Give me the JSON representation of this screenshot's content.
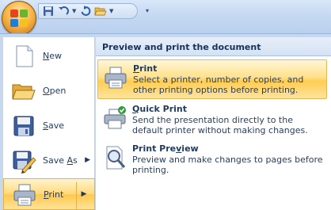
{
  "quick_access": {
    "icons": [
      "save-icon",
      "undo-icon",
      "redo-icon",
      "open-icon",
      "customize-arrow-icon"
    ]
  },
  "left_menu": {
    "items": [
      {
        "prefix": "",
        "accel": "N",
        "suffix": "ew",
        "icon": "new-document-icon"
      },
      {
        "prefix": "",
        "accel": "O",
        "suffix": "pen",
        "icon": "open-folder-icon"
      },
      {
        "prefix": "",
        "accel": "S",
        "suffix": "ave",
        "icon": "save-disk-icon"
      },
      {
        "prefix": "Save ",
        "accel": "A",
        "suffix": "s",
        "icon": "save-as-icon"
      },
      {
        "prefix": "",
        "accel": "P",
        "suffix": "rint",
        "icon": "printer-icon"
      }
    ]
  },
  "right_panel": {
    "header": "Preview and print the document",
    "options": [
      {
        "title_prefix": "",
        "title_accel": "P",
        "title_suffix": "rint",
        "description": "Select a printer, number of copies, and other printing options before printing.",
        "icon": "printer-icon"
      },
      {
        "title_prefix": "",
        "title_accel": "Q",
        "title_suffix": "uick Print",
        "description": "Send the presentation directly to the default printer without making changes.",
        "icon": "quick-print-icon"
      },
      {
        "title_prefix": "Print Pre",
        "title_accel": "v",
        "title_suffix": "iew",
        "description": "Preview and make changes to pages before printing.",
        "icon": "print-preview-icon"
      }
    ]
  },
  "colors": {
    "highlight": "#ffd978",
    "menu_frame": "#c6d8ee",
    "text": "#15325b"
  }
}
